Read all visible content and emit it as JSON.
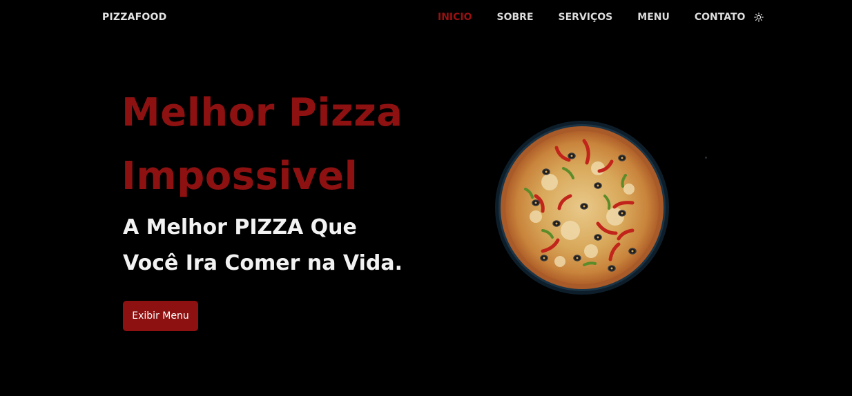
{
  "brand": {
    "logo": "PIZZAFOOD"
  },
  "nav": {
    "items": [
      {
        "label": "INICIO",
        "active": true
      },
      {
        "label": "SOBRE",
        "active": false
      },
      {
        "label": "SERVIÇOS",
        "active": false
      },
      {
        "label": "MENU",
        "active": false
      },
      {
        "label": "CONTATO",
        "active": false
      }
    ],
    "theme_toggle_icon": "sun-icon"
  },
  "hero": {
    "title_line1": "Melhor Pizza",
    "title_line2": "Impossivel",
    "subtitle_line1": "A Melhor PIZZA Que",
    "subtitle_line2": "Você Ira Comer na Vida.",
    "cta_label": "Exibir Menu",
    "image_icon": "pizza-image"
  },
  "colors": {
    "background": "#000000",
    "accent": "#8e1111",
    "text": "#f2f2f2"
  }
}
